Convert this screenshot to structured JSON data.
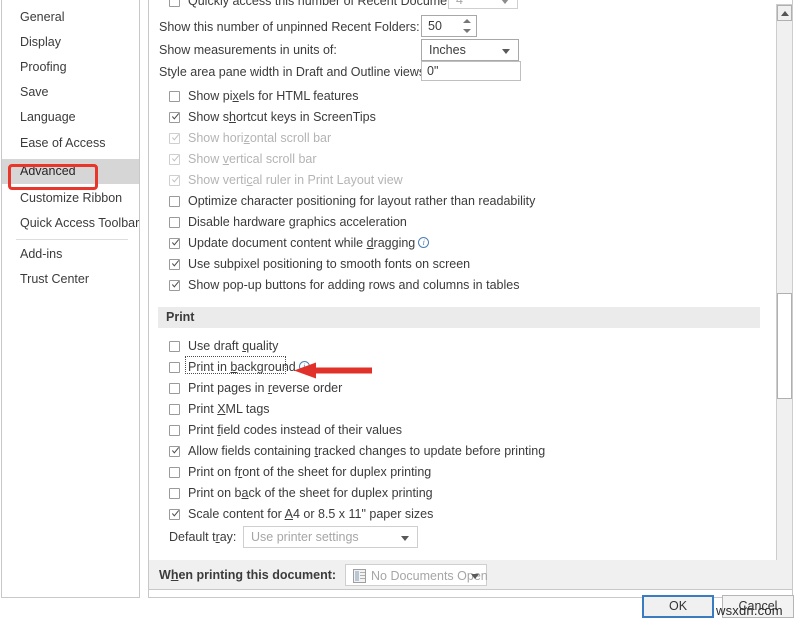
{
  "colors": {
    "accent_red": "#e8362a",
    "focus_blue": "#3a7cc0",
    "selected_nav_bg": "#d6d6d6",
    "section_bar_bg": "#ebebeb",
    "info_icon_blue": "#4a7fb5"
  },
  "sidebar": {
    "items": [
      {
        "label": "General",
        "selected": false
      },
      {
        "label": "Display",
        "selected": false
      },
      {
        "label": "Proofing",
        "selected": false
      },
      {
        "label": "Save",
        "selected": false
      },
      {
        "label": "Language",
        "selected": false
      },
      {
        "label": "Ease of Access",
        "selected": false
      },
      {
        "label": "Advanced",
        "selected": true
      },
      {
        "label": "Customize Ribbon",
        "selected": false
      },
      {
        "label": "Quick Access Toolbar",
        "selected": false
      },
      {
        "label": "Add-ins",
        "selected": false
      },
      {
        "label": "Trust Center",
        "selected": false
      }
    ]
  },
  "display_section": {
    "recent_documents": {
      "label": "Quickly access this number of Recent Documents:",
      "checked": false,
      "value": "4"
    },
    "recent_folders": {
      "label": "Show this number of unpinned Recent Folders:",
      "value": "50"
    },
    "measurement_units": {
      "label": "Show measurements in units of:",
      "value": "Inches"
    },
    "style_area_pane": {
      "label": "Style area pane width in Draft and Outline views:",
      "value": "0\""
    },
    "checkboxes": [
      {
        "label": "Show pixels for HTML features",
        "checked": false,
        "disabled": false,
        "underline": "x"
      },
      {
        "label": "Show shortcut keys in ScreenTips",
        "checked": true,
        "disabled": false,
        "underline": "h"
      },
      {
        "label": "Show horizontal scroll bar",
        "checked": true,
        "disabled": true,
        "underline": "z"
      },
      {
        "label": "Show vertical scroll bar",
        "checked": true,
        "disabled": true,
        "underline": "v"
      },
      {
        "label": "Show vertical ruler in Print Layout view",
        "checked": true,
        "disabled": true,
        "underline": "c"
      },
      {
        "label": "Optimize character positioning for layout rather than readability",
        "checked": false,
        "disabled": false,
        "underline": "z"
      },
      {
        "label": "Disable hardware graphics acceleration",
        "checked": false,
        "disabled": false,
        "underline": "g"
      },
      {
        "label": "Update document content while dragging",
        "checked": true,
        "disabled": false,
        "underline": "d",
        "info": true
      },
      {
        "label": "Use subpixel positioning to smooth fonts on screen",
        "checked": true,
        "disabled": false,
        "underline": ""
      },
      {
        "label": "Show pop-up buttons for adding rows and columns in tables",
        "checked": true,
        "disabled": false,
        "underline": ""
      }
    ]
  },
  "print_section": {
    "title": "Print",
    "checkboxes": [
      {
        "label": "Use draft quality",
        "checked": false,
        "focused": false,
        "underline": "q"
      },
      {
        "label": "Print in background",
        "checked": false,
        "focused": true,
        "underline": "b",
        "info": true
      },
      {
        "label": "Print pages in reverse order",
        "checked": false,
        "focused": false,
        "underline": "r"
      },
      {
        "label": "Print XML tags",
        "checked": false,
        "focused": false,
        "underline": "X"
      },
      {
        "label": "Print field codes instead of their values",
        "checked": false,
        "focused": false,
        "underline": "f"
      },
      {
        "label": "Allow fields containing tracked changes to update before printing",
        "checked": true,
        "focused": false,
        "underline": "t"
      },
      {
        "label": "Print on front of the sheet for duplex printing",
        "checked": false,
        "focused": false,
        "underline": "r"
      },
      {
        "label": "Print on back of the sheet for duplex printing",
        "checked": false,
        "focused": false,
        "underline": "a"
      },
      {
        "label": "Scale content for A4 or 8.5 x 11\" paper sizes",
        "checked": true,
        "focused": false,
        "underline": "A"
      }
    ],
    "default_tray": {
      "label": "Default tray:",
      "value": "Use printer settings"
    }
  },
  "footer": {
    "label": "When printing this document:",
    "document_value": "No Documents Open",
    "doc_icon": "word-document-icon"
  },
  "buttons": {
    "ok": "OK",
    "cancel": "Cancel"
  },
  "annotation": {
    "arrow": "red-left-arrow",
    "highlight": "red-rounded-rectangle"
  },
  "watermark": "wsxdn.com",
  "scrollbar": {
    "up_icon": "scroll-up-arrow-icon",
    "down_icon": "scroll-down-arrow-icon"
  }
}
